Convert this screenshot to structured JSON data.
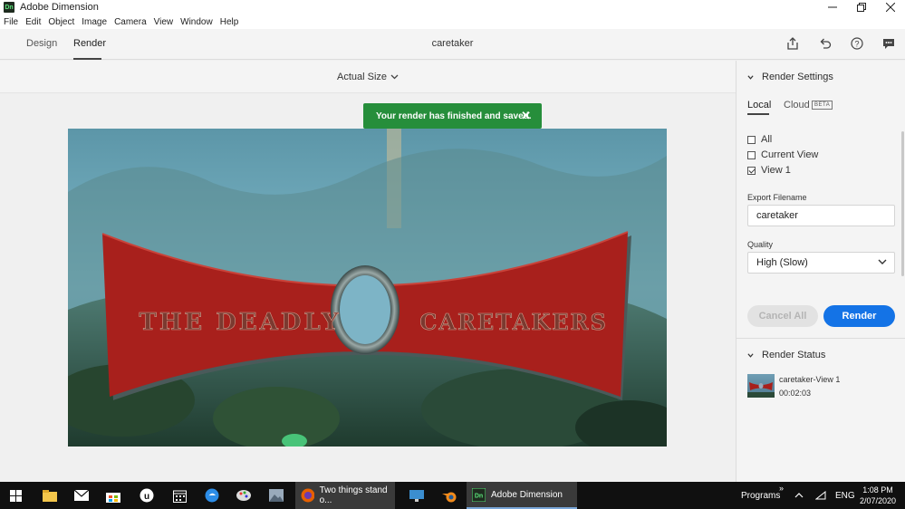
{
  "window": {
    "app_name": "Adobe Dimension",
    "icon_text": "Dn",
    "controls": [
      "minimize",
      "restore",
      "close"
    ]
  },
  "menu": [
    "File",
    "Edit",
    "Object",
    "Image",
    "Camera",
    "View",
    "Window",
    "Help"
  ],
  "header": {
    "tabs": [
      {
        "label": "Design",
        "active": false
      },
      {
        "label": "Render",
        "active": true
      }
    ],
    "document_title": "caretaker",
    "icons": [
      "share-icon",
      "undo-icon",
      "help-icon",
      "feedback-icon"
    ]
  },
  "canvas": {
    "zoom_label": "Actual Size",
    "toast": "Your render has finished and saved.",
    "scene_text": {
      "left": "THE DEADLY",
      "right": "CARETAKERS"
    }
  },
  "render_settings": {
    "title": "Render Settings",
    "tabs": {
      "local": "Local",
      "cloud": "Cloud",
      "beta_badge": "BETA"
    },
    "views": [
      {
        "label": "All",
        "checked": false
      },
      {
        "label": "Current View",
        "checked": false
      },
      {
        "label": "View 1",
        "checked": true
      }
    ],
    "export_filename_label": "Export Filename",
    "export_filename": "caretaker",
    "quality_label": "Quality",
    "quality": "High (Slow)",
    "cancel_all": "Cancel All",
    "render": "Render"
  },
  "render_status": {
    "title": "Render Status",
    "items": [
      {
        "name": "caretaker-View 1",
        "time": "00:02:03"
      }
    ]
  },
  "taskbar": {
    "active_app": "Adobe Dimension",
    "firefox_window": "Two things stand o...",
    "programs_label": "Programs",
    "language": "ENG",
    "time": "1:08 PM",
    "date": "2/07/2020"
  },
  "colors": {
    "toast_bg": "#268e3b",
    "primary_button": "#1473e6",
    "banner_red": "#a8201c"
  }
}
